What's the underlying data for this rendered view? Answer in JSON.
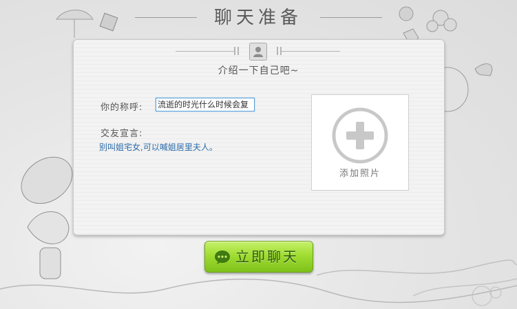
{
  "window": {
    "title": "聊天准备"
  },
  "card": {
    "intro": "介绍一下自己吧~",
    "nickname_label": "你的称呼:",
    "nickname_value": "流逝的时光什么时候会复",
    "declaration_label": "交友宣言:",
    "declaration_text": "别叫姐宅女,可以喊姐居里夫人。",
    "add_photo_label": "添加照片"
  },
  "actions": {
    "start_chat_label": "立即聊天"
  },
  "colors": {
    "button_green": "#a1dd33",
    "link_blue": "#2a6aa8",
    "input_border": "#5aa0d8"
  },
  "icons": {
    "avatar": "person-silhouette-icon",
    "add_photo": "plus-circle-icon",
    "chat": "speech-bubble-icon"
  }
}
